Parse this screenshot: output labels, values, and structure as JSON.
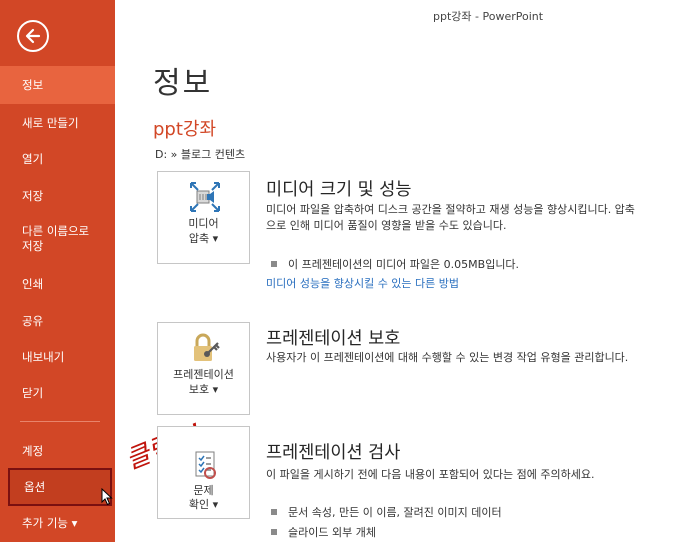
{
  "window": {
    "title": "ppt강좌 - PowerPoint"
  },
  "sidebar": {
    "back_icon": "back-arrow-icon",
    "items": [
      {
        "label": "정보",
        "state": "selected"
      },
      {
        "label": "새로 만들기"
      },
      {
        "label": "열기"
      },
      {
        "label": "저장"
      },
      {
        "label": "다른 이름으로 저장"
      },
      {
        "label": "인쇄"
      },
      {
        "label": "공유"
      },
      {
        "label": "내보내기"
      },
      {
        "label": "닫기"
      },
      {
        "label": "계정"
      },
      {
        "label": "옵션",
        "state": "hover"
      },
      {
        "label": "추가 기능 ▾"
      }
    ]
  },
  "main": {
    "heading": "정보",
    "document_name": "ppt강좌",
    "document_path": "D: » 블로그 컨텐츠",
    "sections": [
      {
        "button_line1": "미디어",
        "button_line2": "압축 ▾",
        "icon": "media-compress-icon",
        "title": "미디어 크기 및 성능",
        "description": "미디어 파일을 압축하여 디스크 공간을 절약하고 재생 성능을 향상시킵니다. 압축으로 인해 미디어 품질이 영향을 받을 수도 있습니다.",
        "bullets": [
          "이 프레젠테이션의 미디어 파일은 0.05MB입니다."
        ],
        "link": "미디어 성능을 향상시킬 수 있는 다른 방법"
      },
      {
        "button_line1": "프레젠테이션",
        "button_line2": "보호 ▾",
        "icon": "lock-key-icon",
        "title": "프레젠테이션 보호",
        "description": "사용자가 이 프레젠테이션에 대해 수행할 수 있는 변경 작업 유형을 관리합니다."
      },
      {
        "button_line1": "문제",
        "button_line2": "확인 ▾",
        "icon": "inspect-checklist-icon",
        "title": "프레젠테이션 검사",
        "description": "이 파일을 게시하기 전에 다음 내용이 포함되어 있다는 점에 주의하세요.",
        "bullets": [
          "문서 속성, 만든 이 이름, 잘려진 이미지 데이터",
          "슬라이드 외부 개체"
        ]
      }
    ]
  },
  "annotation": {
    "text": "클릭~!",
    "color": "#c0140c"
  },
  "colors": {
    "accent": "#d24726",
    "selected": "#e8643f",
    "link": "#2a6fbf"
  }
}
